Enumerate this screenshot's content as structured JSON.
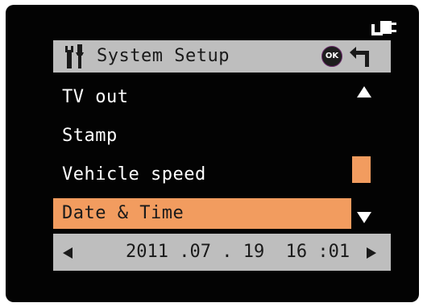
{
  "screen": {
    "title": "System Setup",
    "ok_label": "OK",
    "colors": {
      "background": "#030303",
      "header_bar": "#bebebe",
      "highlight": "#f29c5f",
      "text": "#ffffff"
    },
    "icons": {
      "power": "power-plug-icon",
      "settings": "tools-icon",
      "back": "back-arrow-icon",
      "scroll_up": "triangle-up-icon",
      "scroll_down": "triangle-down-icon",
      "prev": "triangle-left-icon",
      "next": "triangle-right-icon"
    }
  },
  "menu": {
    "items": [
      {
        "label": "TV out"
      },
      {
        "label": "Stamp"
      },
      {
        "label": "Vehicle speed"
      },
      {
        "label": "Date & Time"
      }
    ],
    "selected_label": "Date & Time"
  },
  "value": {
    "datetime": "2011 .07 . 19  16 :01"
  }
}
